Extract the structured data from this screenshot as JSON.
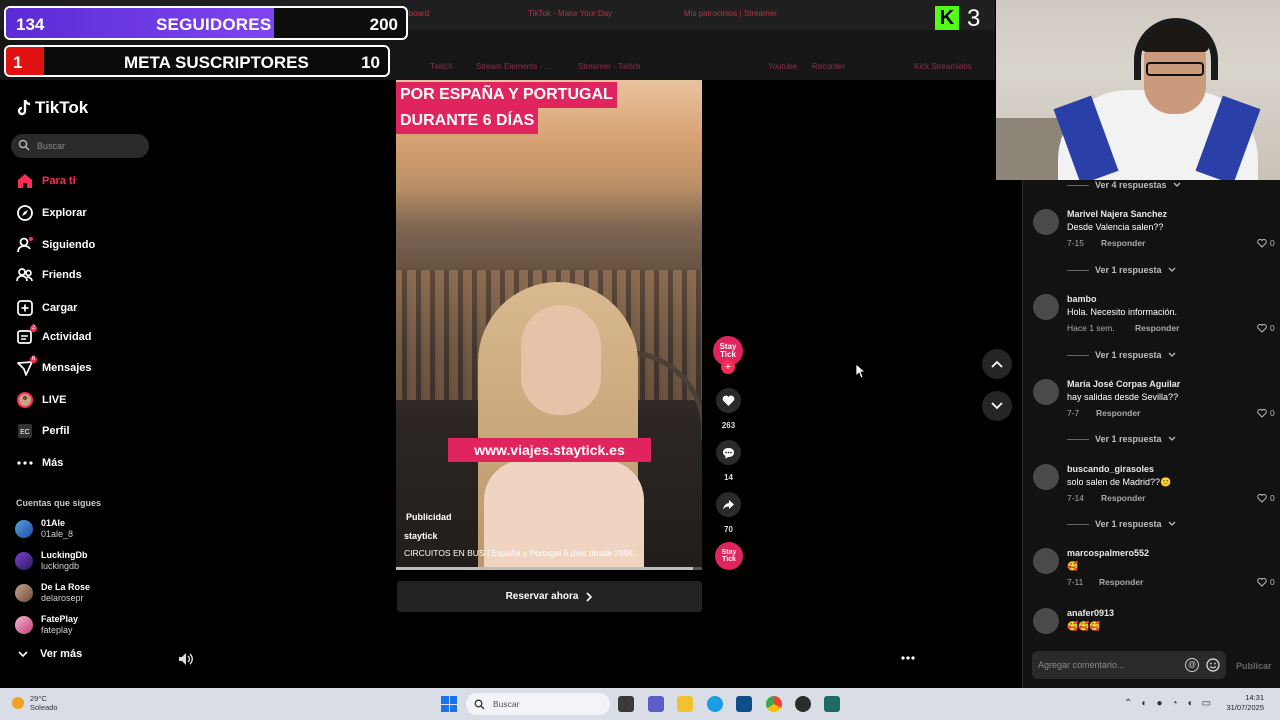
{
  "browser": {
    "tabs": [
      "Dashboard",
      "TikTok - Make Your Day",
      "Mis patrocinios | Streamer"
    ],
    "bookmarks": [
      "Twitch",
      "Stream Elements - ...",
      "Streamer - Twitch",
      "Youtube",
      "Recorder",
      "Kick Streamlabs"
    ]
  },
  "overlays": {
    "followers": {
      "current": "134",
      "title": "SEGUIDORES",
      "goal": "200",
      "progress": 0.67
    },
    "subs": {
      "current": "1",
      "title": "META SUSCRIPTORES",
      "goal": "10",
      "progress": 0.1
    },
    "kick": {
      "logo": "K",
      "viewers": "3",
      "color": "#53fc18"
    }
  },
  "tiktok": {
    "logo": "TikTok",
    "search_placeholder": "Buscar",
    "accent": "#fe2c55",
    "nav": [
      {
        "label": "Para ti",
        "icon": "home-icon",
        "active": true
      },
      {
        "label": "Explorar",
        "icon": "compass-icon"
      },
      {
        "label": "Siguiendo",
        "icon": "following-icon"
      },
      {
        "label": "Friends",
        "icon": "friends-icon"
      },
      {
        "label": "Cargar",
        "icon": "upload-icon"
      },
      {
        "label": "Actividad",
        "icon": "activity-icon",
        "badge": "2"
      },
      {
        "label": "Mensajes",
        "icon": "messages-icon",
        "badge": "6"
      },
      {
        "label": "LIVE",
        "icon": "live-icon"
      },
      {
        "label": "Perfil",
        "icon": "profile-icon"
      },
      {
        "label": "Más",
        "icon": "more-icon"
      }
    ],
    "following_title": "Cuentas que sigues",
    "following": [
      {
        "name": "01Ale",
        "handle": "01ale_8"
      },
      {
        "name": "LuckingDb",
        "handle": "luckingdb"
      },
      {
        "name": "De La Rose",
        "handle": "delarosepr"
      },
      {
        "name": "FatePlay",
        "handle": "fateplay"
      }
    ],
    "see_more": "Ver más"
  },
  "video": {
    "headline_1": "POR ESPAÑA Y PORTUGAL",
    "headline_2": "DURANTE 6 DÍAS",
    "url": "www.viajes.staytick.es",
    "ad_label": "Publicidad",
    "author": "staytick",
    "description": "CIRCUITOS EN BUS | España y Portugal 6 días desde  299€",
    "cta": "Reservar ahora",
    "progress": 0.97
  },
  "actions": {
    "avatar_text": "Stay Tick",
    "likes": "263",
    "comments": "14",
    "shares": "70",
    "disc_text": "Stay Tick"
  },
  "comments": {
    "top_replies": "Ver 4 respuestas",
    "items": [
      {
        "name": "Marivel Najera Sanchez",
        "text": "Desde Valencia salen??",
        "date": "7-15",
        "reply": "Responder",
        "likes": "0",
        "replies": "Ver 1 respuesta"
      },
      {
        "name": "bambo",
        "text": "Hola. Necesito información.",
        "date": "Hace 1 sem.",
        "reply": "Responder",
        "likes": "0",
        "replies": "Ver 1 respuesta"
      },
      {
        "name": "María José Corpas Aguilar",
        "text": "hay salidas desde Sevilla??",
        "date": "7-7",
        "reply": "Responder",
        "likes": "0",
        "replies": "Ver 1 respuesta"
      },
      {
        "name": "buscando_girasoles",
        "text": "solo salen de Madrid??😕",
        "date": "7-14",
        "reply": "Responder",
        "likes": "0",
        "replies": "Ver 1 respuesta"
      },
      {
        "name": "marcospalmero552",
        "text": "🥰",
        "date": "7-11",
        "reply": "Responder",
        "likes": "0"
      },
      {
        "name": "anafer0913",
        "text": "🥰🥰🥰",
        "date": "",
        "reply": "",
        "likes": ""
      }
    ],
    "input_placeholder": "Agregar comentario...",
    "mention_icon": "@",
    "publish": "Publicar"
  },
  "taskbar": {
    "weather_temp": "29°C",
    "weather_desc": "Soleado",
    "search_placeholder": "Buscar",
    "time": "14:31",
    "date": "31/07/2025"
  }
}
